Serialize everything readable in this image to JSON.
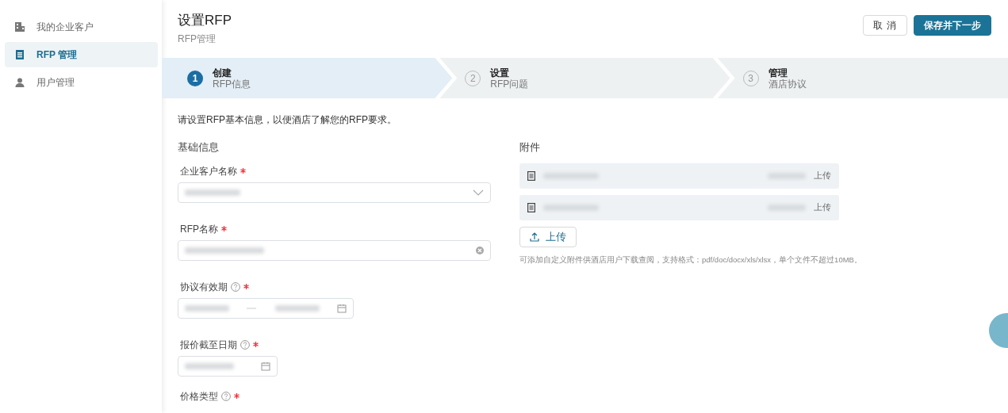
{
  "sidebar": {
    "items": [
      {
        "label": "我的企业客户",
        "selected": false
      },
      {
        "label": "RFP 管理",
        "selected": true
      },
      {
        "label": "用户管理",
        "selected": false
      }
    ]
  },
  "header": {
    "title": "设置RFP",
    "subtitle": "RFP管理",
    "buttons": [
      {
        "label": "取 消",
        "kind": "secondary"
      },
      {
        "label": "保存并下一步",
        "kind": "primary"
      }
    ]
  },
  "steps": [
    {
      "number": "1",
      "title": "创建",
      "subtitle": "RFP信息",
      "selected": true
    },
    {
      "number": "2",
      "title": "设置",
      "subtitle": "RFP问题",
      "selected": false
    },
    {
      "number": "3",
      "title": "管理",
      "subtitle": "酒店协议",
      "selected": false
    }
  ],
  "intro": "请设置RFP基本信息，以便酒店了解您的RFP要求。",
  "basic_info": {
    "heading": "基础信息",
    "fields": [
      {
        "kind": "select",
        "label": "企业客户名称",
        "required": true,
        "help": false,
        "redacted": true
      },
      {
        "kind": "text",
        "label": "RFP名称",
        "required": true,
        "help": false,
        "redacted": true
      },
      {
        "kind": "daterange",
        "label": "协议有效期",
        "required": true,
        "help": true,
        "redacted": true
      },
      {
        "kind": "date",
        "label": "报价截至日期",
        "required": true,
        "help": true,
        "redacted": true
      },
      {
        "kind": "label_only",
        "label": "价格类型",
        "required": true,
        "help": true,
        "redacted": false
      }
    ]
  },
  "attachments": {
    "heading": "附件",
    "files": [
      {
        "uploaded": "上传",
        "redacted": true
      },
      {
        "uploaded": "上传",
        "redacted": true
      }
    ],
    "upload_button": "上传",
    "hint": "可添加自定义附件供酒店用户下载查阅，支持格式：pdf/doc/docx/xls/xlsx，单个文件不超过10MB。"
  }
}
